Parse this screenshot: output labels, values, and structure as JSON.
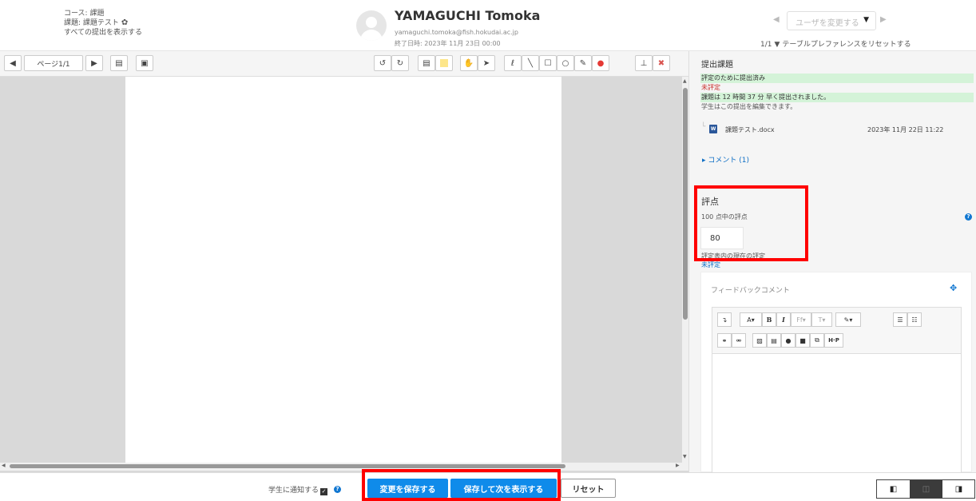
{
  "header": {
    "course": "コース: 課題",
    "assignment": "課題: 課題テスト",
    "view_all": "すべての提出を表示する",
    "user_name": "YAMAGUCHI Tomoka",
    "user_email": "yamaguchi.tomoka@fish.hokudai.ac.jp",
    "due_date": "終了日時: 2023年 11月 23日 00:00",
    "user_select_placeholder": "ユーザを変更する",
    "user_count": "1/1",
    "reset_prefs": "テーブルプレファレンスをリセットする"
  },
  "toolbar": {
    "page_label": "ページ1/1"
  },
  "side": {
    "title": "提出課題",
    "status_graded": "評定のために提出済み",
    "status_ungraded": "未評定",
    "status_early": "課題は 12 時間 37 分 早く提出されました。",
    "status_editable": "学生はこの提出を編集できます。",
    "file_name": "課題テスト.docx",
    "file_date": "2023年 11月 22日 11:22",
    "comments": "コメント (1)",
    "grade_title": "評点",
    "grade_out_of": "100 点中の評点",
    "grade_value": "80",
    "current_grade_label": "評定表内の現在の評定",
    "current_grade_value": "未評定",
    "feedback_title": "フィードバックコメント"
  },
  "footer": {
    "notify_label": "学生に通知する",
    "save_label": "変更を保存する",
    "save_next_label": "保存して次を表示する",
    "reset_label": "リセット"
  },
  "colors": {
    "primary": "#0f8bea",
    "highlight_red": "#ff0000",
    "status_green": "#d4f3d8"
  }
}
